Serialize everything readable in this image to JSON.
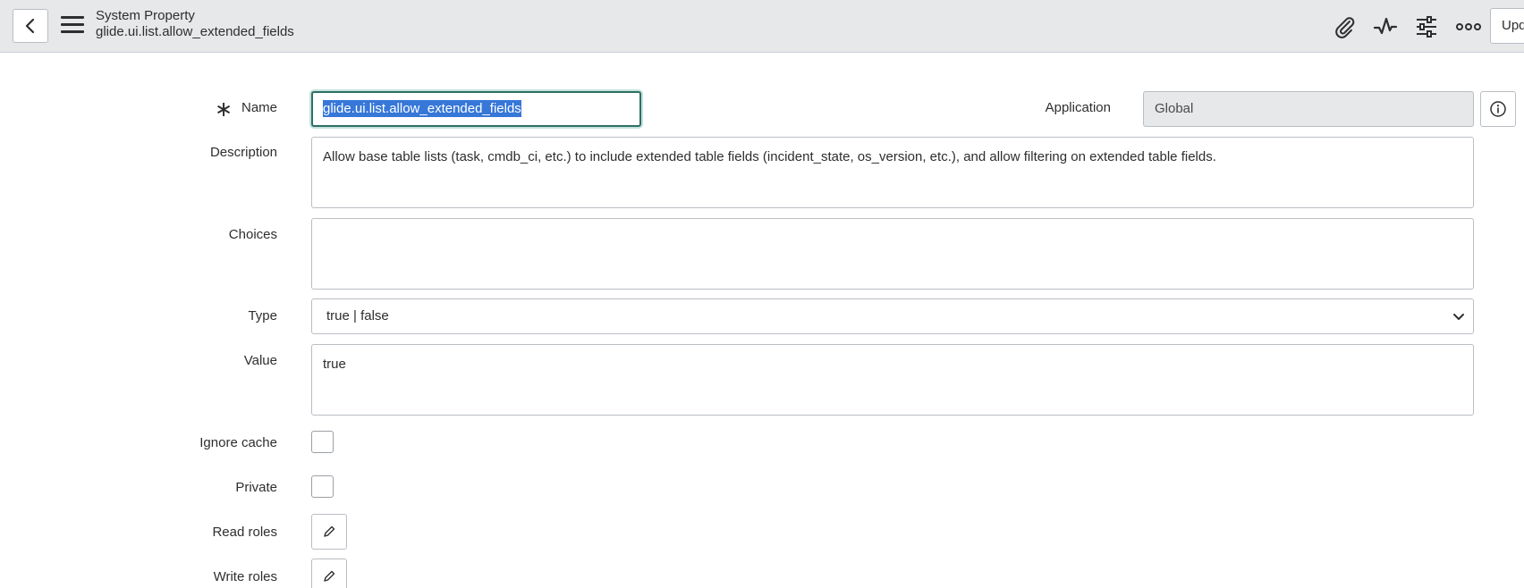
{
  "header": {
    "title": "System Property",
    "subtitle": "glide.ui.list.allow_extended_fields",
    "update_label": "Upd",
    "icons": [
      "chevron-left-icon",
      "hamburger-menu-icon",
      "paperclip-icon",
      "activity-icon",
      "sliders-icon",
      "more-icon"
    ]
  },
  "form": {
    "name_label": "Name",
    "name_value": "glide.ui.list.allow_extended_fields",
    "application_label": "Application",
    "application_value": "Global",
    "description_label": "Description",
    "description_value": "Allow base table lists (task, cmdb_ci, etc.) to include extended table fields (incident_state, os_version, etc.), and allow filtering on extended table fields.",
    "choices_label": "Choices",
    "choices_value": "",
    "type_label": "Type",
    "type_value": "true | false",
    "value_label": "Value",
    "value_value": "true",
    "ignore_cache_label": "Ignore cache",
    "ignore_cache_checked": false,
    "private_label": "Private",
    "private_checked": false,
    "read_roles_label": "Read roles",
    "write_roles_label": "Write roles",
    "mandatory_marker": "∗"
  },
  "colors": {
    "header_bg": "#e6e8ea",
    "focus_border": "#2f6f64",
    "selection": "#3677d8",
    "readonly_bg": "#e6e8ea"
  }
}
